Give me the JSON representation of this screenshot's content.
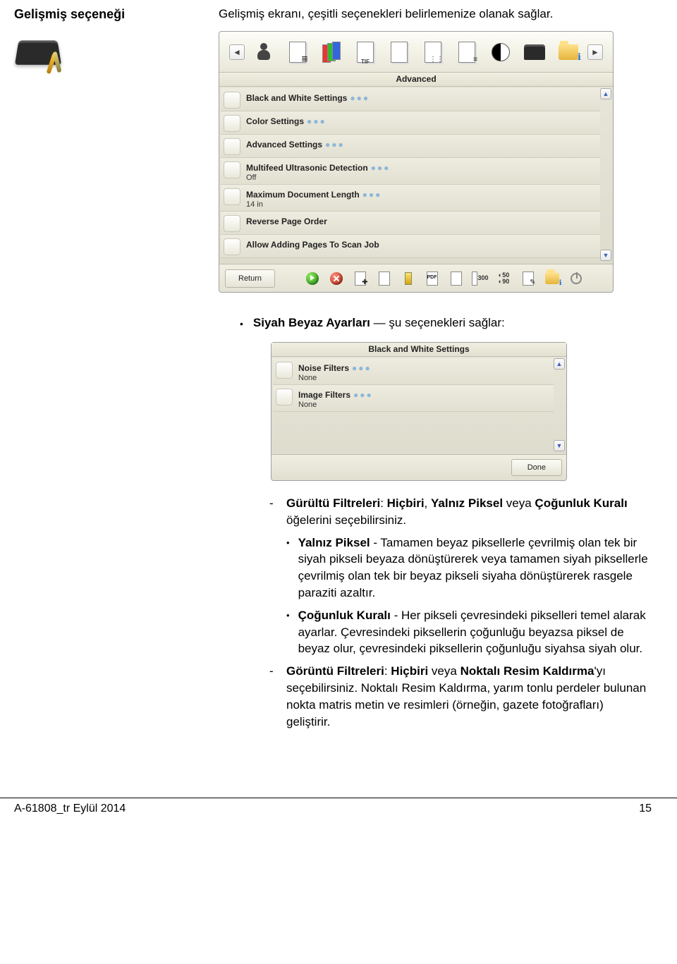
{
  "heading": "Gelişmiş seçeneği",
  "intro": "Gelişmiş ekranı, çeşitli seçenekleri belirlemenize olanak sağlar.",
  "adv_panel": {
    "title": "Advanced",
    "toolbar_icons": [
      "person",
      "pages",
      "color-pages",
      "tif-doc",
      "blank-doc",
      "dotted-doc",
      "lined-doc",
      "contrast",
      "scanner",
      "info-folder"
    ],
    "tif_label": "TIF",
    "rows": [
      {
        "title": "Black and White Settings",
        "sub": ""
      },
      {
        "title": "Color Settings",
        "sub": ""
      },
      {
        "title": "Advanced Settings",
        "sub": ""
      },
      {
        "title": "Multifeed Ultrasonic Detection",
        "sub": "Off"
      },
      {
        "title": "Maximum Document Length",
        "sub": "14 in"
      },
      {
        "title": "Reverse Page Order",
        "sub": ""
      },
      {
        "title": "Allow Adding Pages To Scan Job",
        "sub": ""
      }
    ],
    "return_label": "Return",
    "num300": "300",
    "num50": "50",
    "num90": "90",
    "pdf_label": "PDF"
  },
  "bullet1_bold": "Siyah Beyaz Ayarları",
  "bullet1_tail": " — şu seçenekleri sağlar:",
  "bw_panel": {
    "title": "Black and White Settings",
    "rows": [
      {
        "title": "Noise Filters",
        "sub": "None"
      },
      {
        "title": "Image Filters",
        "sub": "None"
      }
    ],
    "done_label": "Done"
  },
  "sub_noise": {
    "b1": "Gürültü Filtreleri",
    "t1": ": ",
    "b2": "Hiçbiri",
    "t2": ", ",
    "b3": "Yalnız Piksel",
    "t3": " veya ",
    "b4": "Çoğunluk Kuralı",
    "t4": " öğelerini seçebilirsiniz."
  },
  "sub_lonepixel": {
    "b": "Yalnız Piksel",
    "t": " - Tamamen beyaz piksellerle çevrilmiş olan tek bir siyah pikseli beyaza dönüştürerek veya tamamen siyah piksellerle çevrilmiş olan tek bir beyaz pikseli siyaha dönüştürerek rasgele paraziti azaltır."
  },
  "sub_majority": {
    "b": "Çoğunluk Kuralı",
    "t": " - Her pikseli çevresindeki pikselleri temel alarak ayarlar. Çevresindeki piksellerin çoğunluğu beyazsa piksel de beyaz olur, çevresindeki piksellerin çoğunluğu siyahsa siyah olur."
  },
  "sub_imagefilters": {
    "b1": "Görüntü Filtreleri",
    "t1": ": ",
    "b2": "Hiçbiri",
    "t2": " veya ",
    "b3": "Noktalı Resim Kaldırma",
    "t3": "'yı seçebilirsiniz. Noktalı Resim Kaldırma, yarım tonlu perdeler bulunan nokta matris metin ve resimleri (örneğin, gazete fotoğrafları) geliştirir."
  },
  "footer_left": "A-61808_tr  Eylül 2014",
  "footer_right": "15"
}
